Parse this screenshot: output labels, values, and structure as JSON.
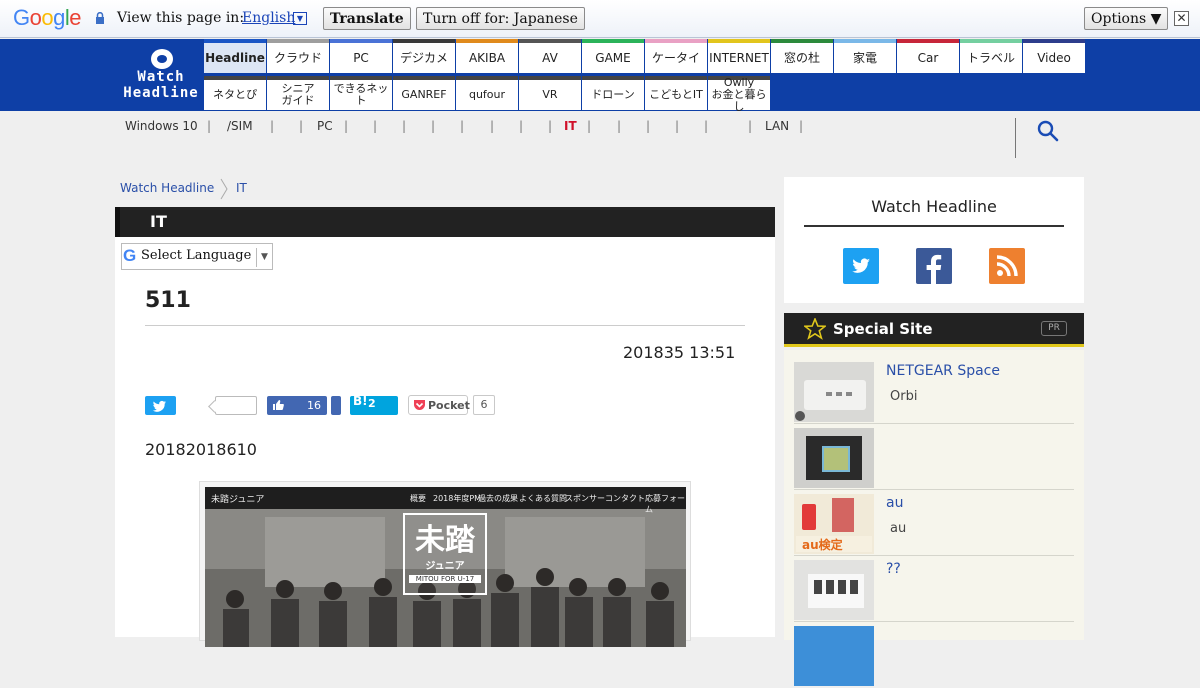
{
  "translate_bar": {
    "logo": "Google",
    "prompt": "View this page in:",
    "language": "English",
    "translate_label": "Translate",
    "turn_off_label": "Turn off for: Japanese",
    "options_label": "Options ▼",
    "close_glyph": "✕"
  },
  "brand": {
    "line1": "Watch",
    "line2": "Headline"
  },
  "nav": {
    "row1": [
      {
        "label": "Headline",
        "color": "#1a55c5"
      },
      {
        "label": "クラウド",
        "color": "#9e9e9e"
      },
      {
        "label": "PC",
        "color": "#4a72d6"
      },
      {
        "label": "デジカメ",
        "color": "#3a3a3a"
      },
      {
        "label": "AKIBA",
        "color": "#e08a1c"
      },
      {
        "label": "AV",
        "color": "#555555"
      },
      {
        "label": "GAME",
        "color": "#2bb35a"
      },
      {
        "label": "ケータイ",
        "color": "#e9a1c4"
      },
      {
        "label": "INTERNET",
        "color": "#e2c51d"
      },
      {
        "label": "窓の杜",
        "color": "#2c8a3c"
      },
      {
        "label": "家電",
        "color": "#7ab8e8"
      },
      {
        "label": "Car",
        "color": "#c7263a"
      },
      {
        "label": "トラベル",
        "color": "#74cfa0"
      },
      {
        "label": "Video",
        "color": "#2d3d8c"
      }
    ],
    "row2": [
      {
        "label": "ネタとぴ"
      },
      {
        "label": "シニア\nガイド"
      },
      {
        "label": "できるネット"
      },
      {
        "label": "GANREF"
      },
      {
        "label": "qufour"
      },
      {
        "label": "VR"
      },
      {
        "label": "ドローン"
      },
      {
        "label": "こどもとIT"
      },
      {
        "label": "Owlly\nお金と暮らし"
      }
    ]
  },
  "subnav": {
    "items": [
      "Windows 10",
      "/SIM",
      "PC",
      "IT",
      "LAN"
    ],
    "active": "IT",
    "separator": "|"
  },
  "breadcrumb": {
    "home": "Watch Headline",
    "current": "IT"
  },
  "article": {
    "category": "IT",
    "select_language": "Select Language",
    "title": "511",
    "date": "201835 13:51",
    "facebook_count": "16",
    "hatena_label": "B!",
    "hatena_count": "2",
    "pocket_label": "Pocket",
    "pocket_count": "6",
    "paragraph": "20182018610",
    "image": {
      "site_name": "未踏ジュニア",
      "menu": [
        "概要",
        "2018年度PM",
        "過去の成果",
        "よくある質問",
        "スポンサー",
        "コンタクト",
        "応募フォーム"
      ],
      "logo_main": "未踏",
      "logo_sub": "ジュニア",
      "logo_caption": "MITOU FOR U-17"
    }
  },
  "sidebar": {
    "follow_title": "Watch Headline",
    "social": [
      {
        "name": "twitter",
        "color": "#1da1f2"
      },
      {
        "name": "facebook",
        "color": "#3b5998"
      },
      {
        "name": "rss",
        "color": "#ee802f"
      }
    ],
    "special_title": "Special Site",
    "pr_label": "PR",
    "special_items": [
      {
        "name": "NETGEAR Space",
        "sub": "Orbi"
      },
      {
        "name": "",
        "sub": ""
      },
      {
        "name": "au",
        "sub": "au"
      },
      {
        "name": "??",
        "sub": ""
      }
    ]
  },
  "colors": {
    "header_blue": "#0e3fa6",
    "link_blue": "#2a4fa8",
    "accent_red": "#d0102a",
    "special_gold": "#e0c71c"
  }
}
